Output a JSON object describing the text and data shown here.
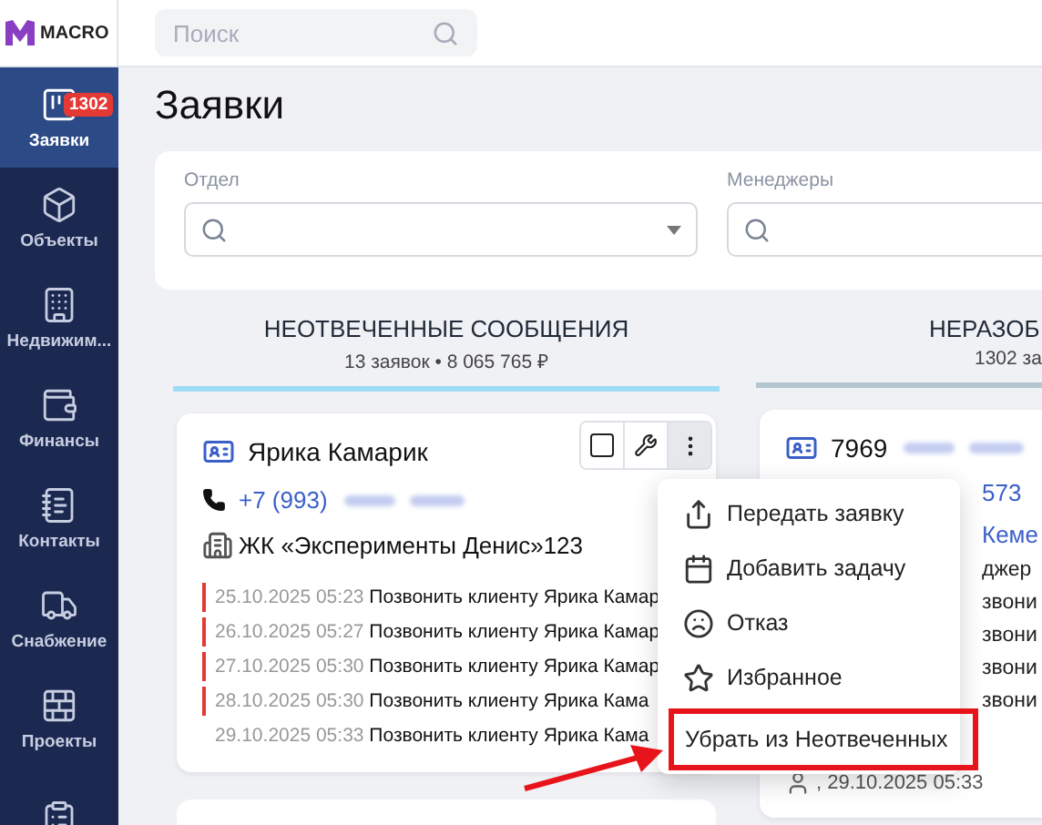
{
  "logo": {
    "text": "MACRO"
  },
  "search": {
    "placeholder": "Поиск"
  },
  "sidebar": {
    "items": [
      {
        "label": "Заявки",
        "selected": true,
        "badge": "1302"
      },
      {
        "label": "Объекты",
        "selected": false
      },
      {
        "label": "Недвижим...",
        "selected": false
      },
      {
        "label": "Финансы",
        "selected": false
      },
      {
        "label": "Контакты",
        "selected": false
      },
      {
        "label": "Снабжение",
        "selected": false
      },
      {
        "label": "Проекты",
        "selected": false
      },
      {
        "selected": false
      }
    ]
  },
  "page_title": "Заявки",
  "filters": [
    {
      "label": "Отдел",
      "kind": "select"
    },
    {
      "label": "Менеджеры",
      "kind": "search"
    }
  ],
  "columns": [
    {
      "title": "НЕОТВЕЧЕННЫЕ СООБЩЕНИЯ",
      "summary": "13 заявок • 8 065 765 ₽",
      "color": "#9fdcf5",
      "cards": [
        {
          "kind": "full",
          "name": "Ярика Камарик",
          "phone": "+7 (993)",
          "blurred": true,
          "object": "ЖК «Эксперименты Денис»123",
          "checked": false,
          "tasks": [
            {
              "date": "25.10.2025 05:23",
              "text": "Позвонить клиенту Ярика Камар",
              "overdue": true
            },
            {
              "date": "26.10.2025 05:27",
              "text": "Позвонить клиенту Ярика Камар",
              "overdue": true
            },
            {
              "date": "27.10.2025 05:30",
              "text": "Позвонить клиенту Ярика Камар",
              "overdue": true
            },
            {
              "date": "28.10.2025 05:30",
              "text": "Позвонить клиенту Ярика Кама",
              "overdue": true
            },
            {
              "date": "29.10.2025 05:33",
              "text": "Позвонить клиенту Ярика Кама",
              "overdue": false
            }
          ],
          "menu": [
            {
              "label": "Передать заявку",
              "highlighted": false
            },
            {
              "label": "Добавить задачу",
              "highlighted": false
            },
            {
              "label": "Отказ",
              "highlighted": false
            },
            {
              "label": "Избранное",
              "highlighted": false
            },
            {
              "label": "Убрать из Неотвеченных",
              "highlighted": true
            }
          ]
        },
        {
          "kind": "peek"
        }
      ]
    },
    {
      "title": "НЕРАЗОБ",
      "summary": "1302 за",
      "color": "#b4c6d0",
      "cards": [
        {
          "kind": "partial",
          "name": "7969",
          "blurred": true,
          "lines": [
            {
              "text": "573",
              "kind": "link"
            },
            {
              "text": "Кеме",
              "kind": "link"
            },
            {
              "text": "джер",
              "kind": "text"
            },
            {
              "text": "звони",
              "kind": "text"
            },
            {
              "text": "звони",
              "kind": "text"
            },
            {
              "text": "звони",
              "kind": "text"
            },
            {
              "text": "звони",
              "kind": "text"
            }
          ],
          "footer": ", 29.10.2025 05:33"
        }
      ]
    }
  ]
}
